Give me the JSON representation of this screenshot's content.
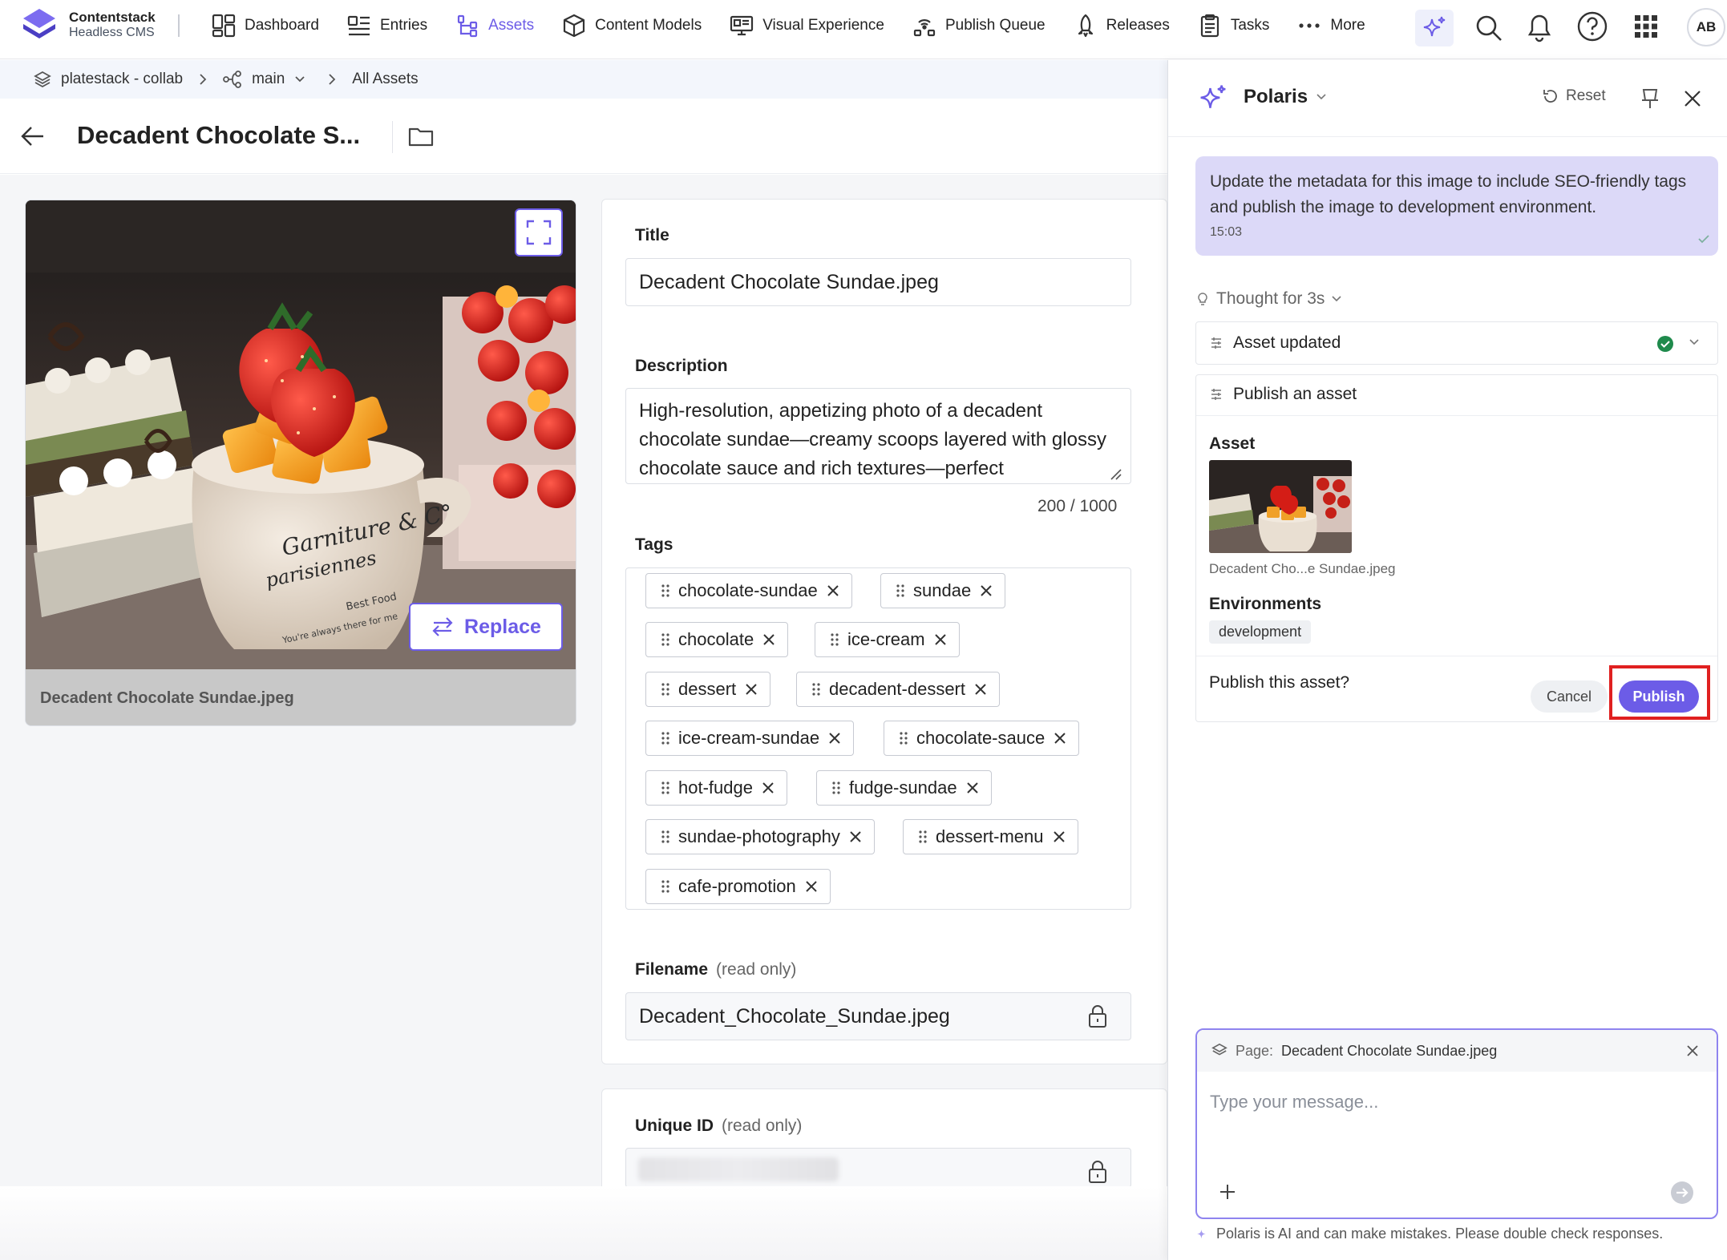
{
  "brand": {
    "name": "Contentstack",
    "product": "Headless CMS"
  },
  "nav": {
    "items": [
      {
        "label": "Dashboard",
        "icon": "dashboard-icon"
      },
      {
        "label": "Entries",
        "icon": "entries-icon"
      },
      {
        "label": "Assets",
        "icon": "assets-icon",
        "active": true
      },
      {
        "label": "Content Models",
        "icon": "cube-icon"
      },
      {
        "label": "Visual Experience",
        "icon": "monitor-icon"
      },
      {
        "label": "Publish Queue",
        "icon": "queue-icon"
      },
      {
        "label": "Releases",
        "icon": "rocket-icon"
      },
      {
        "label": "Tasks",
        "icon": "clipboard-icon"
      },
      {
        "label": "More",
        "icon": "ellipsis-icon"
      }
    ],
    "user_initials": "AB"
  },
  "breadcrumb": {
    "stack": "platestack - collab",
    "branch": "main",
    "page": "All Assets"
  },
  "page": {
    "title": "Decadent Chocolate S..."
  },
  "asset": {
    "caption": "Decadent Chocolate Sundae.jpeg",
    "replace_label": "Replace",
    "image_text_1": "Garniture & C°",
    "image_text_2": "parisiennes",
    "image_text_3": "Best Food",
    "image_text_4": "You're always there for me"
  },
  "form": {
    "title_label": "Title",
    "title_value": "Decadent Chocolate Sundae.jpeg",
    "description_label": "Description",
    "description_value": "High-resolution, appetizing photo of a decadent chocolate sundae—creamy scoops layered with glossy chocolate sauce and rich textures—perfect",
    "description_counter": "200 / 1000",
    "tags_label": "Tags",
    "tags": [
      "chocolate-sundae",
      "sundae",
      "chocolate",
      "ice-cream",
      "dessert",
      "decadent-dessert",
      "ice-cream-sundae",
      "chocolate-sauce",
      "hot-fudge",
      "fudge-sundae",
      "sundae-photography",
      "dessert-menu",
      "cafe-promotion"
    ],
    "filename_label": "Filename",
    "readonly_note": "(read only)",
    "filename_value": "Decadent_Chocolate_Sundae.jpeg",
    "uid_label": "Unique ID"
  },
  "polaris": {
    "title": "Polaris",
    "reset_label": "Reset",
    "user_message": "Update the metadata for this image to include SEO-friendly tags and publish the image to development environment.",
    "message_time": "15:03",
    "thought": "Thought for 3s",
    "step1": "Asset updated",
    "step2": "Publish an asset",
    "asset_label": "Asset",
    "asset_name": "Decadent Cho...e Sundae.jpeg",
    "environments_label": "Environments",
    "environment": "development",
    "confirm_question": "Publish this asset?",
    "cancel_label": "Cancel",
    "publish_label": "Publish",
    "context_prefix": "Page:",
    "context_page": "Decadent Chocolate Sundae.jpeg",
    "composer_placeholder": "Type your message...",
    "disclaimer": "Polaris is AI and can make mistakes. Please double check responses."
  },
  "colors": {
    "accent": "#6c5ce7",
    "highlight": "#e02020",
    "success": "#1f8a4c"
  }
}
